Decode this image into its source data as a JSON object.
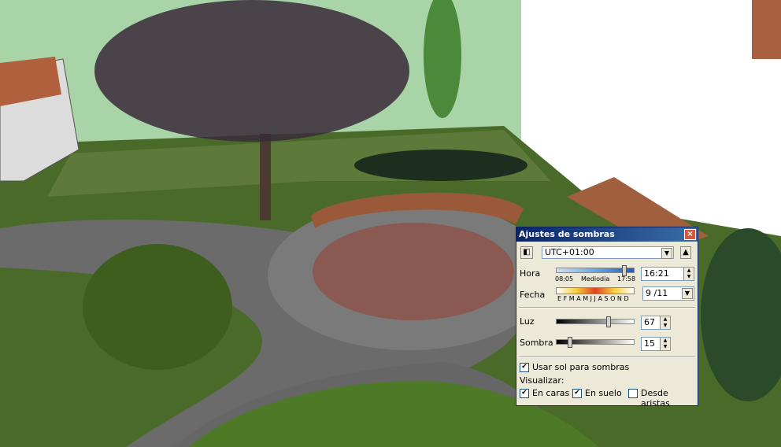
{
  "dialog": {
    "title": "Ajustes de sombras",
    "close_icon": "close-icon",
    "timezone": "UTC+01:00",
    "hora_label": "Hora",
    "hora_ticks": [
      "08:05",
      "Mediodía",
      "17:58"
    ],
    "hora_value": "16:21",
    "fecha_label": "Fecha",
    "fecha_months": "E F M A M J J A S O N D",
    "fecha_value": "9 /11",
    "luz_label": "Luz",
    "luz_value": "67",
    "sombra_label": "Sombra",
    "sombra_value": "15",
    "usar_sol_label": "Usar sol para sombras",
    "usar_sol_checked": true,
    "visualizar_label": "Visualizar:",
    "en_caras_label": "En caras",
    "en_caras_checked": true,
    "en_suelo_label": "En suelo",
    "en_suelo_checked": true,
    "desde_aristas_label": "Desde aristas",
    "desde_aristas_checked": false,
    "hora_slider_level": 0.88,
    "luz_slider_level": 0.67,
    "sombra_slider_level": 0.15
  }
}
